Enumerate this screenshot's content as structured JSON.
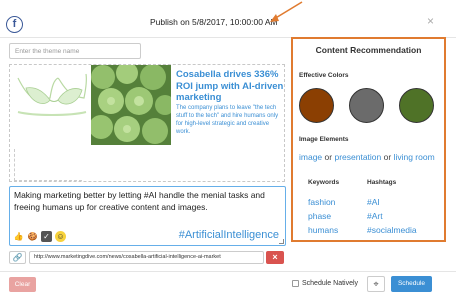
{
  "header": {
    "fb_glyph": "f",
    "title": "Publish on 5/8/2017, 10:00:00 AM",
    "close_glyph": "×"
  },
  "theme_input": {
    "placeholder": "Enter the theme name",
    "value": ""
  },
  "preview": {
    "title": "Cosabella drives 336% ROI jump with AI-driven marketing",
    "description": "The company plans to leave \"the tech stuff to the tech\" and hire humans only for high-level strategic and creative work."
  },
  "post": {
    "text": "Making marketing better by letting #AI handle the menial tasks and freeing humans up for creative content and images.",
    "hashtag": "#ArtificialIntelligence",
    "emojis": [
      {
        "name": "thumbs-up-icon",
        "glyph": "👍"
      },
      {
        "name": "cookie-icon",
        "glyph": "🍪"
      },
      {
        "name": "checkbox-icon",
        "glyph": "✓"
      },
      {
        "name": "smiley-icon",
        "glyph": "☺"
      }
    ]
  },
  "link": {
    "icon_glyph": "🔗",
    "url": "http://www.marketingdive.com/news/cosabella-artificial-intelligence-ai-market",
    "remove_glyph": "×"
  },
  "footer": {
    "clear_label": "Clear",
    "schedule_natively_label": "Schedule Natively",
    "target_glyph": "⌖",
    "schedule_label": "Schedule"
  },
  "recommendation": {
    "title": "Content Recommendation",
    "effective_colors_label": "Effective Colors",
    "colors": [
      "#8b3f02",
      "#6b6b6b",
      "#4f7227"
    ],
    "image_elements_label": "Image Elements",
    "image_elements": [
      "image",
      "presentation",
      "living room"
    ],
    "joiner": "or",
    "keywords_label": "Keywords",
    "hashtags_label": "Hashtags",
    "keywords": [
      "fashion",
      "phase",
      "humans"
    ],
    "hashtags": [
      "#AI",
      "#Art",
      "#socialmedia"
    ]
  },
  "colors": {
    "accent": "#3b8fd4",
    "highlight": "#e07b30",
    "danger": "#d9534f",
    "facebook": "#3b5998"
  }
}
